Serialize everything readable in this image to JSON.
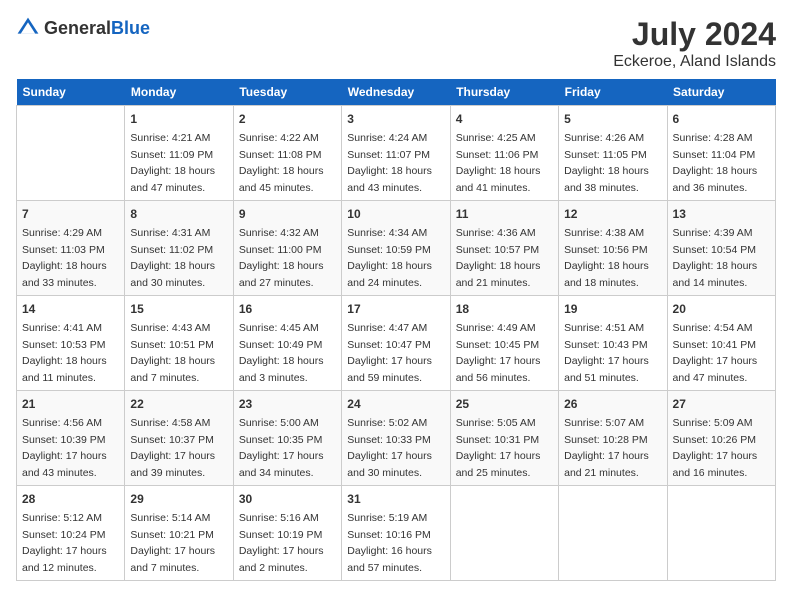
{
  "header": {
    "logo_general": "General",
    "logo_blue": "Blue",
    "month": "July 2024",
    "location": "Eckeroe, Aland Islands"
  },
  "columns": [
    "Sunday",
    "Monday",
    "Tuesday",
    "Wednesday",
    "Thursday",
    "Friday",
    "Saturday"
  ],
  "weeks": [
    [
      {
        "day": "",
        "info": ""
      },
      {
        "day": "1",
        "info": "Sunrise: 4:21 AM\nSunset: 11:09 PM\nDaylight: 18 hours\nand 47 minutes."
      },
      {
        "day": "2",
        "info": "Sunrise: 4:22 AM\nSunset: 11:08 PM\nDaylight: 18 hours\nand 45 minutes."
      },
      {
        "day": "3",
        "info": "Sunrise: 4:24 AM\nSunset: 11:07 PM\nDaylight: 18 hours\nand 43 minutes."
      },
      {
        "day": "4",
        "info": "Sunrise: 4:25 AM\nSunset: 11:06 PM\nDaylight: 18 hours\nand 41 minutes."
      },
      {
        "day": "5",
        "info": "Sunrise: 4:26 AM\nSunset: 11:05 PM\nDaylight: 18 hours\nand 38 minutes."
      },
      {
        "day": "6",
        "info": "Sunrise: 4:28 AM\nSunset: 11:04 PM\nDaylight: 18 hours\nand 36 minutes."
      }
    ],
    [
      {
        "day": "7",
        "info": "Sunrise: 4:29 AM\nSunset: 11:03 PM\nDaylight: 18 hours\nand 33 minutes."
      },
      {
        "day": "8",
        "info": "Sunrise: 4:31 AM\nSunset: 11:02 PM\nDaylight: 18 hours\nand 30 minutes."
      },
      {
        "day": "9",
        "info": "Sunrise: 4:32 AM\nSunset: 11:00 PM\nDaylight: 18 hours\nand 27 minutes."
      },
      {
        "day": "10",
        "info": "Sunrise: 4:34 AM\nSunset: 10:59 PM\nDaylight: 18 hours\nand 24 minutes."
      },
      {
        "day": "11",
        "info": "Sunrise: 4:36 AM\nSunset: 10:57 PM\nDaylight: 18 hours\nand 21 minutes."
      },
      {
        "day": "12",
        "info": "Sunrise: 4:38 AM\nSunset: 10:56 PM\nDaylight: 18 hours\nand 18 minutes."
      },
      {
        "day": "13",
        "info": "Sunrise: 4:39 AM\nSunset: 10:54 PM\nDaylight: 18 hours\nand 14 minutes."
      }
    ],
    [
      {
        "day": "14",
        "info": "Sunrise: 4:41 AM\nSunset: 10:53 PM\nDaylight: 18 hours\nand 11 minutes."
      },
      {
        "day": "15",
        "info": "Sunrise: 4:43 AM\nSunset: 10:51 PM\nDaylight: 18 hours\nand 7 minutes."
      },
      {
        "day": "16",
        "info": "Sunrise: 4:45 AM\nSunset: 10:49 PM\nDaylight: 18 hours\nand 3 minutes."
      },
      {
        "day": "17",
        "info": "Sunrise: 4:47 AM\nSunset: 10:47 PM\nDaylight: 17 hours\nand 59 minutes."
      },
      {
        "day": "18",
        "info": "Sunrise: 4:49 AM\nSunset: 10:45 PM\nDaylight: 17 hours\nand 56 minutes."
      },
      {
        "day": "19",
        "info": "Sunrise: 4:51 AM\nSunset: 10:43 PM\nDaylight: 17 hours\nand 51 minutes."
      },
      {
        "day": "20",
        "info": "Sunrise: 4:54 AM\nSunset: 10:41 PM\nDaylight: 17 hours\nand 47 minutes."
      }
    ],
    [
      {
        "day": "21",
        "info": "Sunrise: 4:56 AM\nSunset: 10:39 PM\nDaylight: 17 hours\nand 43 minutes."
      },
      {
        "day": "22",
        "info": "Sunrise: 4:58 AM\nSunset: 10:37 PM\nDaylight: 17 hours\nand 39 minutes."
      },
      {
        "day": "23",
        "info": "Sunrise: 5:00 AM\nSunset: 10:35 PM\nDaylight: 17 hours\nand 34 minutes."
      },
      {
        "day": "24",
        "info": "Sunrise: 5:02 AM\nSunset: 10:33 PM\nDaylight: 17 hours\nand 30 minutes."
      },
      {
        "day": "25",
        "info": "Sunrise: 5:05 AM\nSunset: 10:31 PM\nDaylight: 17 hours\nand 25 minutes."
      },
      {
        "day": "26",
        "info": "Sunrise: 5:07 AM\nSunset: 10:28 PM\nDaylight: 17 hours\nand 21 minutes."
      },
      {
        "day": "27",
        "info": "Sunrise: 5:09 AM\nSunset: 10:26 PM\nDaylight: 17 hours\nand 16 minutes."
      }
    ],
    [
      {
        "day": "28",
        "info": "Sunrise: 5:12 AM\nSunset: 10:24 PM\nDaylight: 17 hours\nand 12 minutes."
      },
      {
        "day": "29",
        "info": "Sunrise: 5:14 AM\nSunset: 10:21 PM\nDaylight: 17 hours\nand 7 minutes."
      },
      {
        "day": "30",
        "info": "Sunrise: 5:16 AM\nSunset: 10:19 PM\nDaylight: 17 hours\nand 2 minutes."
      },
      {
        "day": "31",
        "info": "Sunrise: 5:19 AM\nSunset: 10:16 PM\nDaylight: 16 hours\nand 57 minutes."
      },
      {
        "day": "",
        "info": ""
      },
      {
        "day": "",
        "info": ""
      },
      {
        "day": "",
        "info": ""
      }
    ]
  ]
}
